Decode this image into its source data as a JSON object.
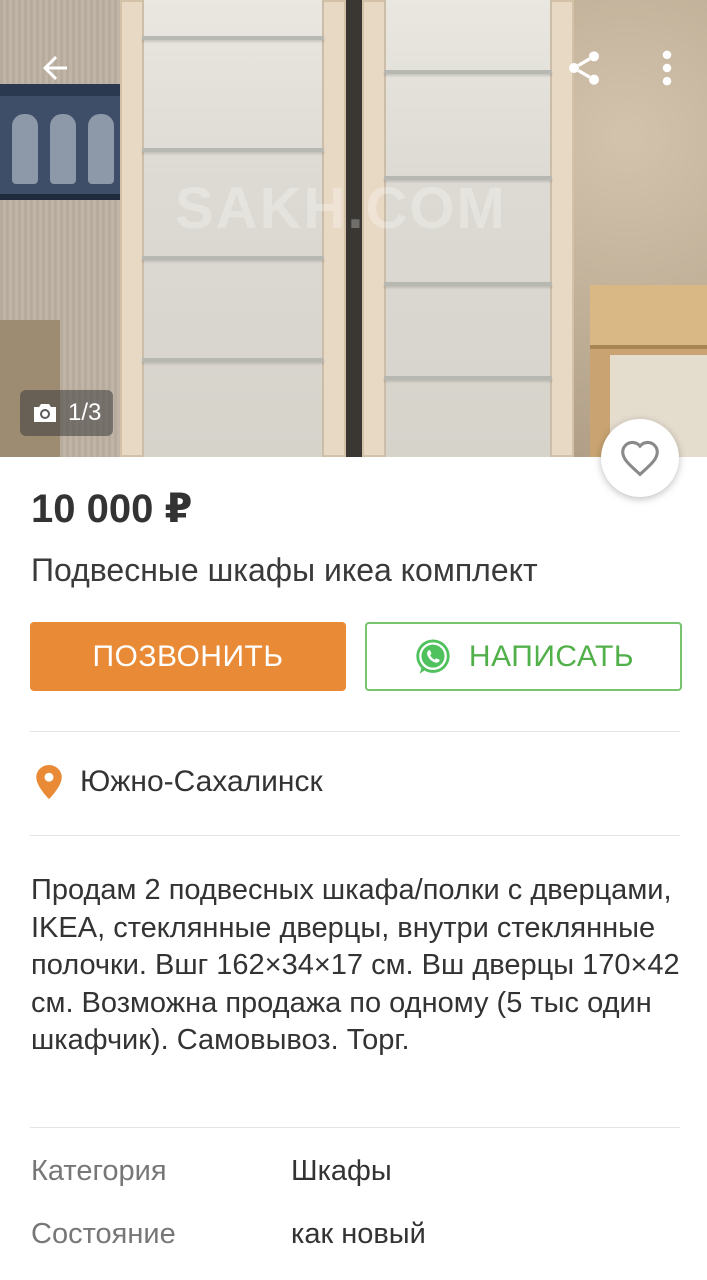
{
  "photo": {
    "counter_text": "1/3",
    "watermark": "SAKH.COM"
  },
  "toolbar": {
    "back_icon": "arrow-left-icon",
    "share_icon": "share-icon",
    "more_icon": "more-vertical-icon",
    "favorite_icon": "heart-outline-icon"
  },
  "listing": {
    "price": "10 000 ₽",
    "title": "Подвесные шкафы икеа комплект",
    "location": "Южно-Сахалинск",
    "description": "Продам 2 подвесных шкафа/полки с дверцами, IKEA, стеклянные дверцы, внутри стеклянные полочки. Вшг 162×34×17 см. Вш дверцы 170×42 см. Возможна продажа по одному (5 тыс один шкафчик). Самовывоз. Торг."
  },
  "actions": {
    "call_label": "ПОЗВОНИТЬ",
    "write_label": "НАПИСАТЬ"
  },
  "properties": [
    {
      "key": "Категория",
      "value": "Шкафы"
    },
    {
      "key": "Состояние",
      "value": "как новый"
    }
  ],
  "colors": {
    "call_button": "#e98a36",
    "write_button_border": "#77c46e",
    "write_button_text": "#52b04a",
    "location_pin": "#e98a36"
  }
}
